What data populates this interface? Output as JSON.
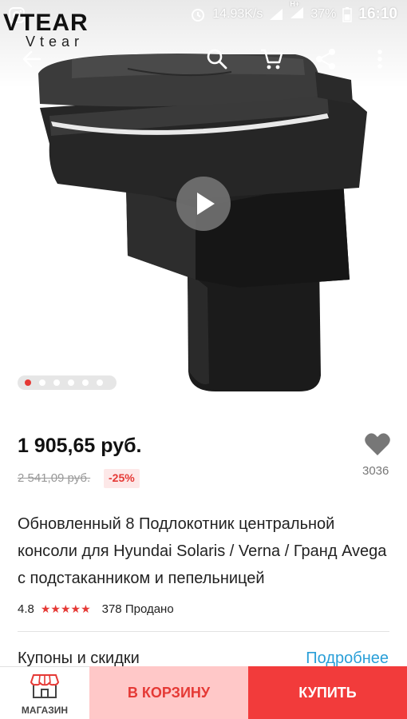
{
  "status_bar": {
    "network_speed": "14.93K/s",
    "network_type": "H+",
    "battery": "37%",
    "time": "16:10"
  },
  "brand": {
    "logo_text": "VTEAR",
    "logo_subtext": "Vtear"
  },
  "toolbar": {
    "icons": [
      "back-arrow-icon",
      "search-icon",
      "cart-icon",
      "share-icon",
      "more-vert-icon"
    ]
  },
  "gallery": {
    "image_count": 6,
    "active_index": 0
  },
  "product": {
    "price": "1 905,65 руб.",
    "old_price": "2 541,09 руб.",
    "discount": "-25%",
    "wishlist_count": "3036",
    "title": "Обновленный 8 Подлокотник  центральной консоли для Hyundai Solaris / Verna / Гранд Avega   с подстаканником и пепельницей",
    "rating": "4.8",
    "stars": "★★★★★",
    "sold": "378 Продано"
  },
  "coupons": {
    "label": "Купоны и скидки",
    "more": "Подробнее"
  },
  "bottom_bar": {
    "store_label": "МАГАЗИН",
    "add_to_cart": "В КОРЗИНУ",
    "buy": "КУПИТЬ"
  },
  "colors": {
    "accent_red": "#f23b3b",
    "cart_pink": "#ffc8c8",
    "link_blue": "#2a9fd8",
    "star_red": "#e53935"
  }
}
